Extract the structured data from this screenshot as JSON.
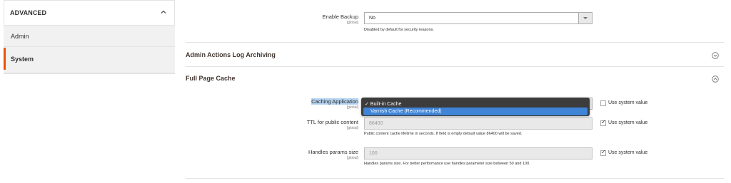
{
  "sidebar": {
    "section_title": "ADVANCED",
    "items": [
      {
        "label": "Admin"
      },
      {
        "label": "System"
      }
    ]
  },
  "enable_backup": {
    "label": "Enable Backup",
    "scope": "[global]",
    "value": "No",
    "note": "Disabled by default for security reasons."
  },
  "sections": {
    "log_archiving": {
      "title": "Admin Actions Log Archiving"
    },
    "full_page_cache": {
      "title": "Full Page Cache"
    }
  },
  "caching_application": {
    "label": "Caching Application",
    "scope": "[global]",
    "options": [
      {
        "label": "✓ Built-in Cache",
        "selected": true
      },
      {
        "label": "Varnish Cache (Recommended)",
        "highlighted": true
      }
    ],
    "use_system_value_label": "Use system value"
  },
  "ttl_public": {
    "label": "TTL for public content",
    "scope": "[global]",
    "value": "86400",
    "note": "Public content cache lifetime in seconds. If field is empty default value 86400 will be saved.",
    "use_system_value_label": "Use system value"
  },
  "handles_params": {
    "label": "Handles params size",
    "scope": "[global]",
    "value": "100",
    "note": "Handles params size. For better performance use handles parameter size between 50 and 100.",
    "use_system_value_label": "Use system value"
  },
  "colors": {
    "accent": "#eb5202",
    "dropdown_bg": "#3c3c3c",
    "dropdown_highlight": "#3f84d7",
    "label_highlight": "#b4d2f0"
  }
}
